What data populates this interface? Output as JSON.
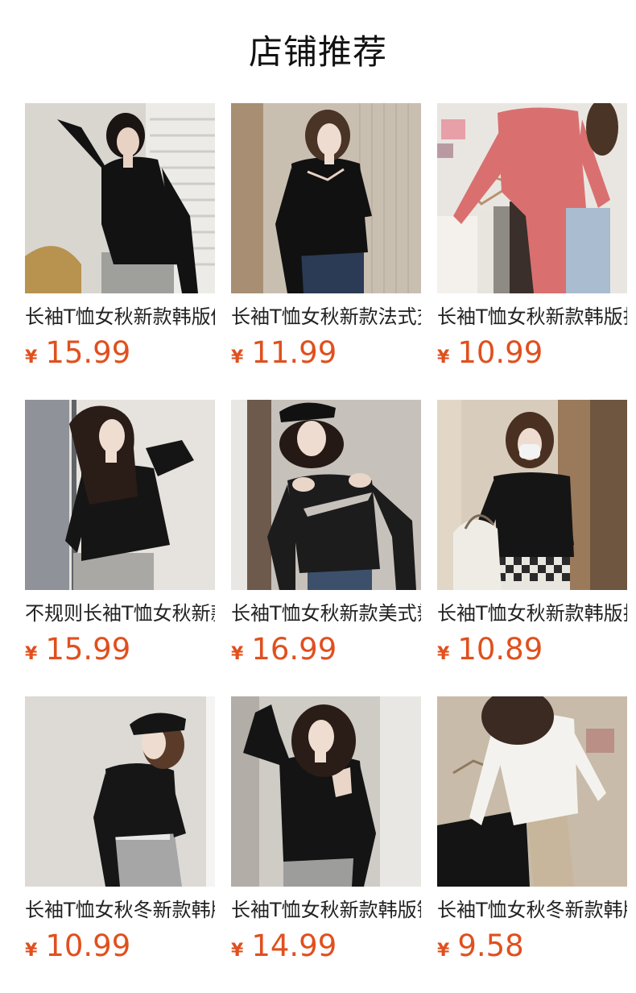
{
  "header": {
    "title": "店铺推荐"
  },
  "products": [
    {
      "title": "长袖T恤女秋新款韩版修身显瘦上衣",
      "currency": "¥",
      "price": "15.99",
      "image": "model-black-top-cutout-shoulder"
    },
    {
      "title": "长袖T恤女秋新款法式交叉上衣",
      "currency": "¥",
      "price": "11.99",
      "image": "model-black-cross-neck-top"
    },
    {
      "title": "长袖T恤女秋新款韩版打底衫",
      "currency": "¥",
      "price": "10.99",
      "image": "pink-top-with-hanging-colors"
    },
    {
      "title": "不规则长袖T恤女秋新款上衣",
      "currency": "¥",
      "price": "15.99",
      "image": "model-black-asymmetric-top"
    },
    {
      "title": "长袖T恤女秋新款美式辣妹上衣",
      "currency": "¥",
      "price": "16.99",
      "image": "model-cap-cutout-top"
    },
    {
      "title": "长袖T恤女秋新款韩版挂脖上衣",
      "currency": "¥",
      "price": "10.89",
      "image": "model-mask-halter-top"
    },
    {
      "title": "长袖T恤女秋冬新款韩版上衣",
      "currency": "¥",
      "price": "10.99",
      "image": "model-cap-gray-pants"
    },
    {
      "title": "长袖T恤女秋新款韩版镂空上衣",
      "currency": "¥",
      "price": "14.99",
      "image": "model-black-shoulder-cutout"
    },
    {
      "title": "长袖T恤女秋冬新款韩版白色上衣",
      "currency": "¥",
      "price": "9.58",
      "image": "white-top-with-hanger"
    }
  ]
}
